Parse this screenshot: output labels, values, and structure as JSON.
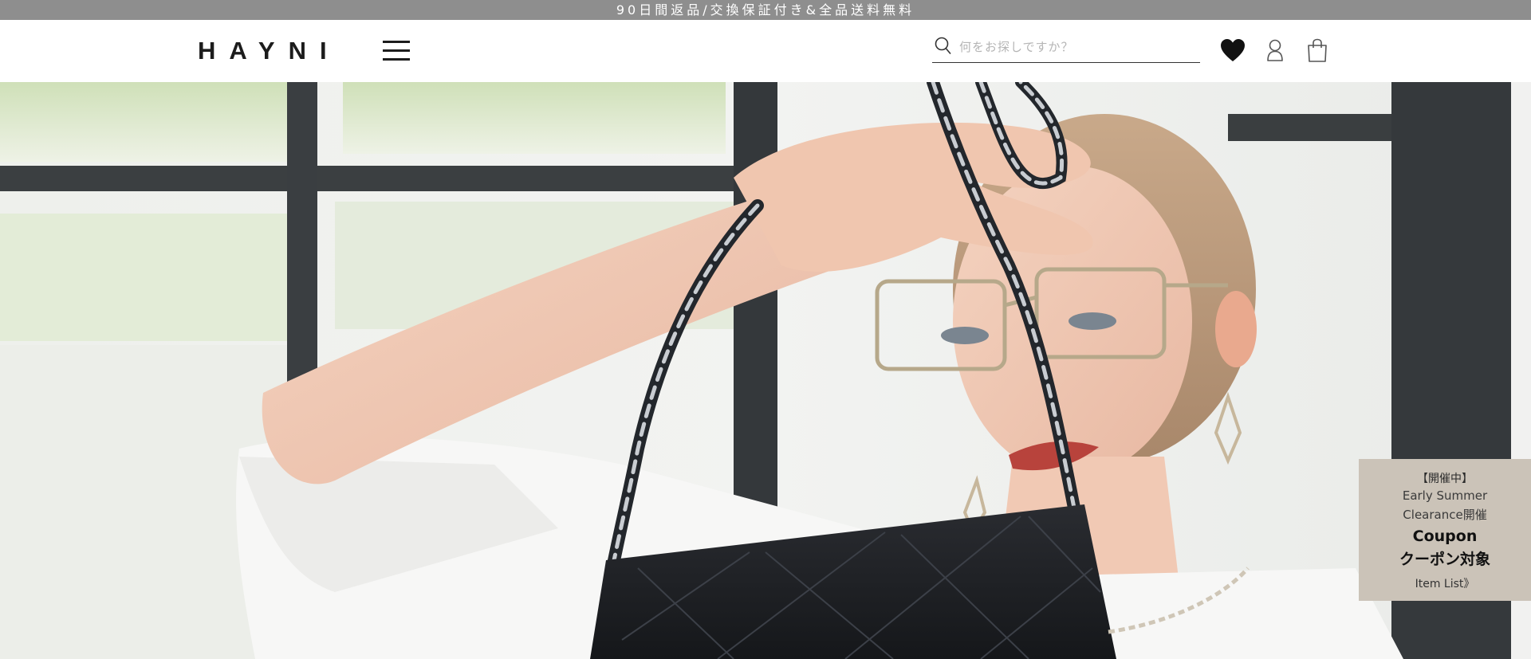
{
  "announcement": {
    "text": "90日間返品/交換保証付き&全品送料無料"
  },
  "header": {
    "logo": "HAYNI",
    "menu_icon": "hamburger-menu-icon",
    "search": {
      "placeholder": "何をお探しですか？",
      "icon": "search-icon"
    },
    "icons": {
      "favorites": "heart-icon",
      "account": "user-icon",
      "cart": "shopping-bag-icon"
    }
  },
  "hero": {
    "image": "model-holding-black-quilted-chain-bag-photo"
  },
  "coupon": {
    "status": "【開催中】",
    "line1": "Early Summer",
    "line2": "Clearance開催",
    "title": "Coupon",
    "subtitle": "クーポン対象",
    "link": "Item List》",
    "bg_color": "#cbc3b8"
  },
  "colors": {
    "announcement_bg": "#8e8e8e",
    "text_dark": "#1c1c1c"
  }
}
